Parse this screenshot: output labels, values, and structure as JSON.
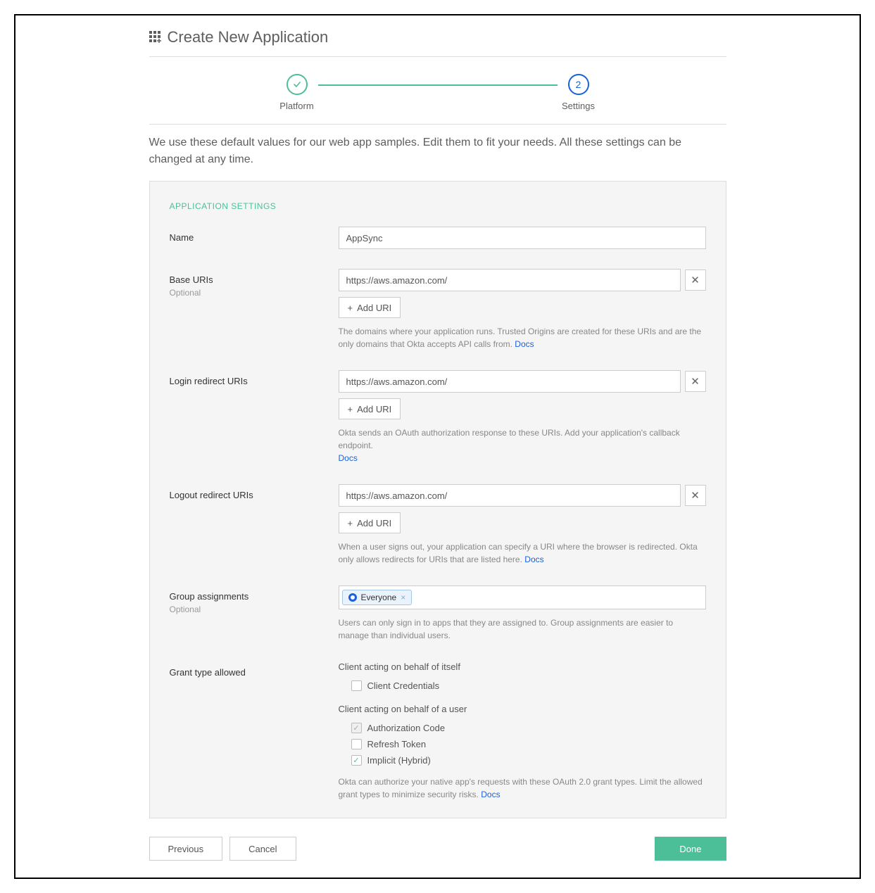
{
  "header": {
    "title": "Create New Application"
  },
  "stepper": {
    "step1_label": "Platform",
    "step2_label": "Settings",
    "step2_num": "2"
  },
  "intro": "We use these default values for our web app samples. Edit them to fit your needs. All these settings can be changed at any time.",
  "section_title": "APPLICATION SETTINGS",
  "fields": {
    "name": {
      "label": "Name",
      "value": "AppSync"
    },
    "base_uris": {
      "label": "Base URIs",
      "sublabel": "Optional",
      "value": "https://aws.amazon.com/",
      "add_label": "Add URI",
      "helper_pre": "The domains where your application runs. Trusted Origins are created for these URIs and are the only domains that Okta accepts API calls from. ",
      "docs": "Docs"
    },
    "login_uris": {
      "label": "Login redirect URIs",
      "value": "https://aws.amazon.com/",
      "add_label": "Add URI",
      "helper_pre": "Okta sends an OAuth authorization response to these URIs. Add your application's callback endpoint. ",
      "docs": "Docs"
    },
    "logout_uris": {
      "label": "Logout redirect URIs",
      "value": "https://aws.amazon.com/",
      "add_label": "Add URI",
      "helper_pre": "When a user signs out, your application can specify a URI where the browser is redirected. Okta only allows redirects for URIs that are listed here. ",
      "docs": "Docs"
    },
    "groups": {
      "label": "Group assignments",
      "sublabel": "Optional",
      "pill": "Everyone",
      "helper": "Users can only sign in to apps that they are assigned to. Group assignments are easier to manage than individual users."
    },
    "grants": {
      "label": "Grant type allowed",
      "self_label": "Client acting on behalf of itself",
      "client_credentials": "Client Credentials",
      "user_label": "Client acting on behalf of a user",
      "auth_code": "Authorization Code",
      "refresh_token": "Refresh Token",
      "implicit": "Implicit (Hybrid)",
      "helper_pre": "Okta can authorize your native app's requests with these OAuth 2.0 grant types. Limit the allowed grant types to minimize security risks. ",
      "docs": "Docs"
    }
  },
  "footer": {
    "previous": "Previous",
    "cancel": "Cancel",
    "done": "Done"
  }
}
